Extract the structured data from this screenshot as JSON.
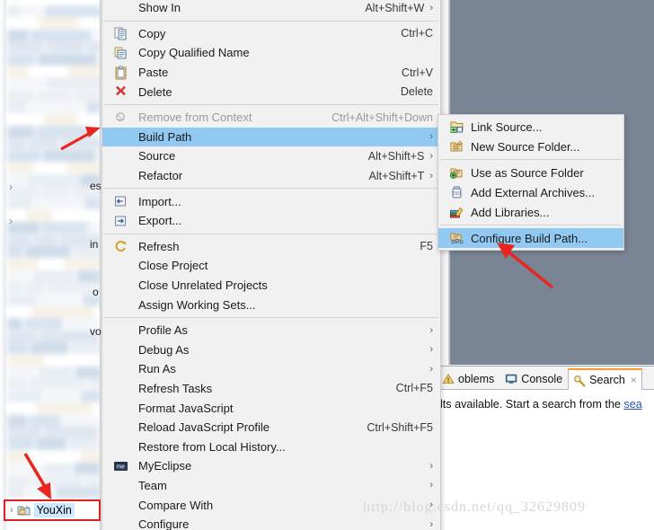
{
  "app": {
    "name": "MyEclipse",
    "watermark": "http://blog.csdn.net/qq_32629809",
    "highlight_color": "#91c9f2",
    "annotation_color": "#e8251f",
    "editor_bg_color": "#798494"
  },
  "explorer": {
    "selected_project": "YouXin",
    "twisty": "›",
    "peek_text": [
      "es",
      "in",
      "vo",
      "o"
    ]
  },
  "context_menu": {
    "items": [
      {
        "label": "Show In",
        "accel": "Alt+Shift+W",
        "arrow": "›",
        "icon": "",
        "state": "clipped"
      },
      {
        "type": "separator"
      },
      {
        "label": "Copy",
        "accel": "Ctrl+C",
        "arrow": "",
        "icon": "copy-icon",
        "state": "normal"
      },
      {
        "label": "Copy Qualified Name",
        "accel": "",
        "arrow": "",
        "icon": "copy-qualified-icon",
        "state": "normal"
      },
      {
        "label": "Paste",
        "accel": "Ctrl+V",
        "arrow": "",
        "icon": "paste-icon",
        "state": "normal"
      },
      {
        "label": "Delete",
        "accel": "Delete",
        "arrow": "",
        "icon": "delete-icon",
        "state": "normal"
      },
      {
        "type": "separator"
      },
      {
        "label": "Remove from Context",
        "accel": "Ctrl+Alt+Shift+Down",
        "arrow": "",
        "icon": "remove-context-icon",
        "state": "disabled"
      },
      {
        "label": "Build Path",
        "accel": "",
        "arrow": "›",
        "icon": "",
        "state": "highlighted"
      },
      {
        "label": "Source",
        "accel": "Alt+Shift+S",
        "arrow": "›",
        "icon": "",
        "state": "normal"
      },
      {
        "label": "Refactor",
        "accel": "Alt+Shift+T",
        "arrow": "›",
        "icon": "",
        "state": "normal"
      },
      {
        "type": "separator"
      },
      {
        "label": "Import...",
        "accel": "",
        "arrow": "",
        "icon": "import-icon",
        "state": "normal"
      },
      {
        "label": "Export...",
        "accel": "",
        "arrow": "",
        "icon": "export-icon",
        "state": "normal"
      },
      {
        "type": "separator"
      },
      {
        "label": "Refresh",
        "accel": "F5",
        "arrow": "",
        "icon": "refresh-icon",
        "state": "normal"
      },
      {
        "label": "Close Project",
        "accel": "",
        "arrow": "",
        "icon": "",
        "state": "normal"
      },
      {
        "label": "Close Unrelated Projects",
        "accel": "",
        "arrow": "",
        "icon": "",
        "state": "normal"
      },
      {
        "label": "Assign Working Sets...",
        "accel": "",
        "arrow": "",
        "icon": "",
        "state": "normal"
      },
      {
        "type": "separator"
      },
      {
        "label": "Profile As",
        "accel": "",
        "arrow": "›",
        "icon": "",
        "state": "normal"
      },
      {
        "label": "Debug As",
        "accel": "",
        "arrow": "›",
        "icon": "",
        "state": "normal"
      },
      {
        "label": "Run As",
        "accel": "",
        "arrow": "›",
        "icon": "",
        "state": "normal"
      },
      {
        "label": "Refresh Tasks",
        "accel": "Ctrl+F5",
        "arrow": "",
        "icon": "",
        "state": "normal"
      },
      {
        "label": "Format JavaScript",
        "accel": "",
        "arrow": "",
        "icon": "",
        "state": "normal"
      },
      {
        "label": "Reload JavaScript Profile",
        "accel": "Ctrl+Shift+F5",
        "arrow": "",
        "icon": "",
        "state": "normal"
      },
      {
        "label": "Restore from Local History...",
        "accel": "",
        "arrow": "",
        "icon": "",
        "state": "normal"
      },
      {
        "label": "MyEclipse",
        "accel": "",
        "arrow": "›",
        "icon": "myeclipse-icon",
        "state": "normal"
      },
      {
        "label": "Team",
        "accel": "",
        "arrow": "›",
        "icon": "",
        "state": "normal"
      },
      {
        "label": "Compare With",
        "accel": "",
        "arrow": "›",
        "icon": "",
        "state": "normal"
      },
      {
        "label": "Configure",
        "accel": "",
        "arrow": "›",
        "icon": "",
        "state": "normal"
      }
    ]
  },
  "build_path_submenu": {
    "items": [
      {
        "label": "Link Source...",
        "icon": "link-source-icon",
        "state": "normal"
      },
      {
        "label": "New Source Folder...",
        "icon": "new-source-folder-icon",
        "state": "normal"
      },
      {
        "type": "separator"
      },
      {
        "label": "Use as Source Folder",
        "icon": "use-as-source-folder-icon",
        "state": "normal"
      },
      {
        "label": "Add External Archives...",
        "icon": "add-external-archives-icon",
        "state": "normal"
      },
      {
        "label": "Add Libraries...",
        "icon": "add-libraries-icon",
        "state": "normal"
      },
      {
        "type": "separator"
      },
      {
        "label": "Configure Build Path...",
        "icon": "configure-build-path-icon",
        "state": "highlighted"
      }
    ]
  },
  "bottom_view": {
    "tabs": [
      {
        "label": "oblems",
        "icon": "problems-icon",
        "active": false,
        "closable": false
      },
      {
        "label": "Console",
        "icon": "console-icon",
        "active": false,
        "closable": false
      },
      {
        "label": "Search",
        "icon": "search-icon",
        "active": true,
        "closable": true
      }
    ],
    "close_glyph": "×",
    "message_prefix": "lts available. Start a search from the ",
    "message_link": "sea"
  }
}
